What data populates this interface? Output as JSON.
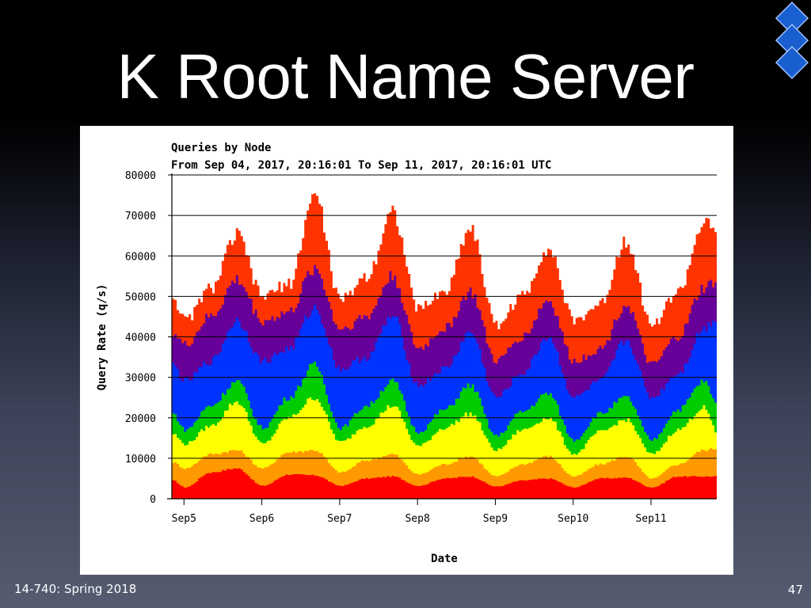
{
  "slide": {
    "title": "K Root Name Server",
    "footer_left": "14-740: Spring 2018",
    "page_number": "47"
  },
  "chart_data": {
    "type": "area",
    "stacked": true,
    "title": "Queries by Node",
    "subtitle": "From Sep 04, 2017, 20:16:01 To Sep 11, 2017, 20:16:01 UTC",
    "xlabel": "Date",
    "ylabel": "Query Rate (q/s)",
    "ylim": [
      0,
      80000
    ],
    "y_ticks": [
      0,
      10000,
      20000,
      30000,
      40000,
      50000,
      60000,
      70000,
      80000
    ],
    "y_tick_labels": [
      "0",
      "10000",
      "20000",
      "30000",
      "40000",
      "50000",
      "60000",
      "70000",
      "80000"
    ],
    "x_range": [
      "2017-09-04 20:16",
      "2017-09-11 20:16"
    ],
    "x_tick_labels": [
      "Sep5",
      "Sep6",
      "Sep7",
      "Sep8",
      "Sep9",
      "Sep10",
      "Sep11"
    ],
    "x_ticks": [
      "2017-09-05",
      "2017-09-06",
      "2017-09-07",
      "2017-09-08",
      "2017-09-09",
      "2017-09-10",
      "2017-09-11"
    ],
    "grid": "horizontal",
    "x": [
      "2017-09-04 20:16",
      "2017-09-05 00:00",
      "2017-09-05 08:00",
      "2017-09-05 16:00",
      "2017-09-06 00:00",
      "2017-09-06 08:00",
      "2017-09-06 16:00",
      "2017-09-07 00:00",
      "2017-09-07 08:00",
      "2017-09-07 16:00",
      "2017-09-08 00:00",
      "2017-09-08 08:00",
      "2017-09-08 16:00",
      "2017-09-09 00:00",
      "2017-09-09 08:00",
      "2017-09-09 16:00",
      "2017-09-10 00:00",
      "2017-09-10 08:00",
      "2017-09-10 16:00",
      "2017-09-11 00:00",
      "2017-09-11 08:00",
      "2017-09-11 16:00",
      "2017-09-11 20:16"
    ],
    "series": [
      {
        "color": "#ff0000",
        "values": [
          4500,
          2800,
          6500,
          7500,
          3200,
          6000,
          5800,
          3200,
          5000,
          5500,
          3200,
          5000,
          5500,
          3000,
          4500,
          5000,
          2800,
          5000,
          5200,
          2800,
          5500,
          5500,
          5500
        ]
      },
      {
        "color": "#ff9900",
        "values": [
          9000,
          7500,
          11000,
          12000,
          7500,
          11500,
          12000,
          6500,
          9500,
          11000,
          6000,
          8500,
          10500,
          5500,
          8500,
          10500,
          5500,
          8500,
          10500,
          5000,
          8500,
          12000,
          12500
        ]
      },
      {
        "color": "#ffff00",
        "values": [
          16000,
          13500,
          18000,
          24000,
          13500,
          20000,
          25000,
          14000,
          18000,
          23000,
          13000,
          17500,
          21000,
          12000,
          17000,
          20000,
          11000,
          16500,
          19500,
          11000,
          17000,
          22500,
          16000
        ]
      },
      {
        "color": "#00cc00",
        "values": [
          21000,
          17000,
          23000,
          29000,
          17500,
          25000,
          33000,
          17500,
          23000,
          29000,
          16500,
          22000,
          28000,
          15500,
          21500,
          26000,
          14500,
          21000,
          25000,
          14500,
          22000,
          29000,
          23000
        ]
      },
      {
        "color": "#0033ff",
        "values": [
          33000,
          29000,
          34000,
          44000,
          34000,
          37000,
          47000,
          32000,
          35000,
          45000,
          28000,
          32000,
          41000,
          25000,
          31000,
          40000,
          25000,
          29000,
          39000,
          25000,
          31000,
          42000,
          45000
        ]
      },
      {
        "color": "#660099",
        "values": [
          41000,
          38000,
          45000,
          54000,
          44000,
          46000,
          57000,
          42000,
          45000,
          55000,
          37000,
          42000,
          51000,
          34000,
          40000,
          49000,
          34000,
          37000,
          48000,
          33000,
          40000,
          52000,
          54000
        ]
      },
      {
        "color": "#ff3300",
        "values": [
          50000,
          44000,
          52000,
          65000,
          50000,
          53000,
          75000,
          49000,
          55000,
          71000,
          47000,
          51000,
          67000,
          43000,
          50000,
          62000,
          44000,
          48000,
          64000,
          43000,
          51000,
          68000,
          65000
        ]
      }
    ]
  }
}
